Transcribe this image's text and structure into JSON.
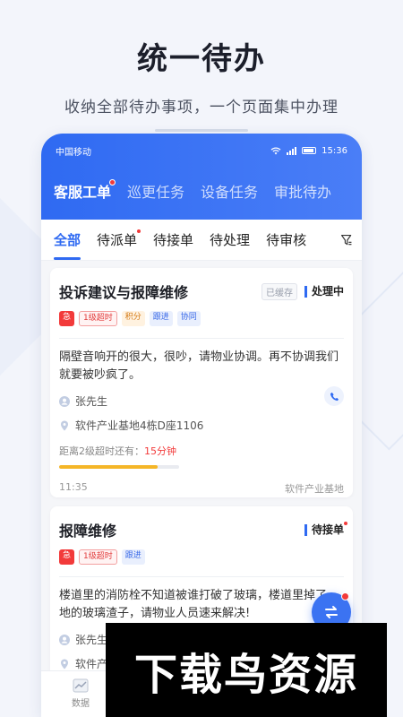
{
  "hero": {
    "title": "统一待办",
    "subtitle": "收纳全部待办事项，一个页面集中办理"
  },
  "status_bar": {
    "carrier": "中国移动",
    "time": "15:36"
  },
  "main_tabs": [
    {
      "label": "客服工单",
      "active": true,
      "dot": true
    },
    {
      "label": "巡更任务"
    },
    {
      "label": "设备任务"
    },
    {
      "label": "审批待办"
    }
  ],
  "sub_tabs": [
    {
      "label": "全部",
      "active": true
    },
    {
      "label": "待派单",
      "dot": true
    },
    {
      "label": "待接单"
    },
    {
      "label": "待处理"
    },
    {
      "label": "待审核"
    }
  ],
  "cards": [
    {
      "title": "投诉建议与报障维修",
      "cache_badge": "已缓存",
      "status": "处理中",
      "tags": [
        "急",
        "1级超时",
        "积分",
        "跟进",
        "协同"
      ],
      "description": "隔壁音响开的很大，很吵，请物业协调。再不协调我们就要被吵疯了。",
      "contact": "张先生",
      "address": "软件产业基地4栋D座1106",
      "countdown_label": "距离2级超时还有：",
      "countdown_value": "15分钟",
      "progress": 0.82,
      "time": "11:35",
      "location": "软件产业基地"
    },
    {
      "title": "报障维修",
      "status": "待接单",
      "tags": [
        "急",
        "1级超时",
        "跟进"
      ],
      "description": "楼道里的消防栓不知道被谁打破了玻璃，楼道里掉了一地的玻璃渣子，请物业人员速来解决!",
      "contact": "张先生",
      "address": "软件产"
    }
  ],
  "bottom_nav": {
    "item1": "数据"
  },
  "watermark": "下载鸟资源",
  "colors": {
    "primary": "#2f6af2",
    "danger": "#f23a3a",
    "warning": "#f5b627"
  }
}
